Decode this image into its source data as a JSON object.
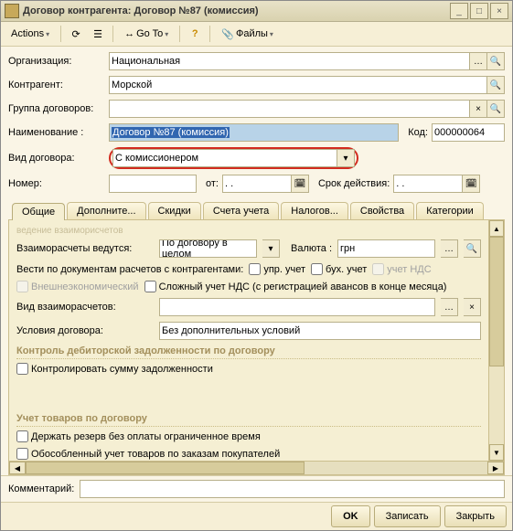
{
  "window": {
    "title": "Договор контрагента: Договор №87 (комиссия)"
  },
  "toolbar": {
    "actions": "Actions",
    "goto": "Go To",
    "files": "Файлы"
  },
  "labels": {
    "org": "Организация:",
    "contr": "Контрагент:",
    "group": "Группа договоров:",
    "name": "Наименование :",
    "code": "Код:",
    "kind": "Вид договора:",
    "number": "Номер:",
    "from": "от:",
    "period": "Срок действия:",
    "comment": "Комментарий:"
  },
  "values": {
    "org": "Национальная",
    "contr": "Морской",
    "group": "",
    "name": "Договор №87 (комиссия)",
    "code": "000000064",
    "kind": "С комиссионером",
    "number": "",
    "date_from": "  .  .    ",
    "date_to": "  .  .    ",
    "comment": ""
  },
  "tabs": [
    "Общие",
    "Дополните...",
    "Скидки",
    "Счета учета",
    "Налогов...",
    "Свойства",
    "Категории"
  ],
  "panel": {
    "faded": "ведение взаиморисчетов",
    "calc_label": "Взаиморасчеты ведутся:",
    "calc_value": "По договору в целом",
    "currency_label": "Валюта :",
    "currency_value": "грн",
    "docs_label": "Вести по документам расчетов с контрагентами:",
    "chk_upr": "упр. учет",
    "chk_buh": "бух. учет",
    "chk_nds": "учет НДС",
    "chk_foreign": "Внешнеэкономический",
    "chk_complex": "Сложный  учет НДС (с регистрацией авансов в конце месяца)",
    "kind_calc_label": "Вид взаиморасчетов:",
    "kind_calc_value": "",
    "terms_label": "Условия договора:",
    "terms_value": "Без дополнительных условий",
    "sect_debit": "Контроль дебиторской задолженности по договору",
    "chk_control": "Контролировать сумму задолженности",
    "sect_goods": "Учет товаров по договору",
    "chk_reserve": "Держать резерв без оплаты ограниченное время",
    "chk_separate": "Обособленный учет товаров по заказам покупателей"
  },
  "footer": {
    "ok": "OK",
    "save": "Записать",
    "close": "Закрыть"
  }
}
